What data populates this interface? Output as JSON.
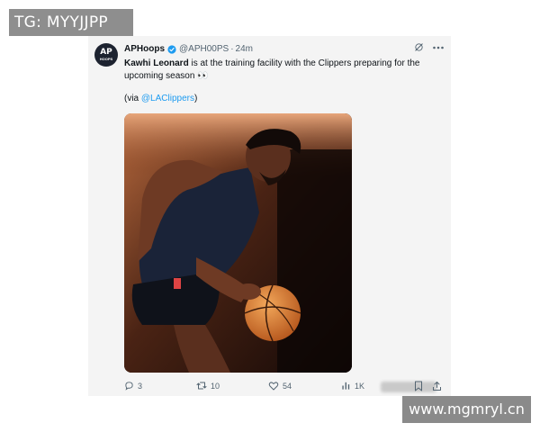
{
  "watermark_top": "TG: MYYJJPP",
  "watermark_bottom": "www.mgmryl.cn",
  "tweet": {
    "avatar": {
      "line1": "AP",
      "line2": "HOOPS"
    },
    "author_name": "APHoops",
    "handle": "@APH00PS",
    "separator": "·",
    "time": "24m",
    "text_bold": "Kawhi Leonard",
    "text_rest": " is at the training facility with the Clippers preparing for the upcoming season 👀",
    "via_prefix": "(via ",
    "via_mention": "@LAClippers",
    "via_suffix": ")",
    "image_alt": "Kawhi Leonard dribbling a basketball at practice",
    "stats": {
      "replies": "3",
      "reposts": "10",
      "likes": "54",
      "views": "1K"
    }
  },
  "colors": {
    "link": "#1d9bf0",
    "verified": "#1d9bf0",
    "muted": "#536471",
    "card_bg": "#f4f4f4"
  }
}
